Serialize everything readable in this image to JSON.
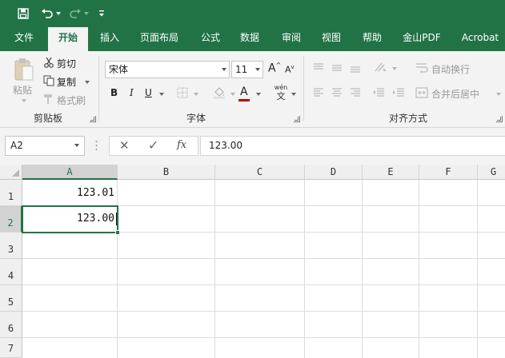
{
  "quick_access": {
    "icons": [
      "save-icon",
      "undo-icon",
      "redo-icon",
      "customize-icon"
    ]
  },
  "tabs": [
    {
      "label": "文件",
      "active": false
    },
    {
      "label": "开始",
      "active": true
    },
    {
      "label": "插入",
      "active": false
    },
    {
      "label": "页面布局",
      "active": false
    },
    {
      "label": "公式",
      "active": false
    },
    {
      "label": "数据",
      "active": false
    },
    {
      "label": "审阅",
      "active": false
    },
    {
      "label": "视图",
      "active": false
    },
    {
      "label": "帮助",
      "active": false
    },
    {
      "label": "金山PDF",
      "active": false
    },
    {
      "label": "Acrobat",
      "active": false
    }
  ],
  "clipboard": {
    "group_label": "剪贴板",
    "paste_label": "粘贴",
    "cut_label": "剪切",
    "copy_label": "复制",
    "format_painter_label": "格式刷"
  },
  "font": {
    "group_label": "字体",
    "font_name": "宋体",
    "font_size": "11",
    "bold_label": "B",
    "italic_label": "I",
    "underline_label": "U",
    "grow_label": "A",
    "shrink_label": "A",
    "font_color_label": "A",
    "phonetic_label": "wén",
    "phonetic_sub": "文"
  },
  "alignment": {
    "group_label": "对齐方式",
    "wrap_text_label": "自动换行",
    "merge_center_label": "合并后居中"
  },
  "formula_bar": {
    "name_box": "A2",
    "cancel_symbol": "✕",
    "enter_symbol": "✓",
    "fx_label": "fx",
    "content": "123.00"
  },
  "sheet": {
    "columns": [
      "A",
      "B",
      "C",
      "D",
      "E",
      "F",
      "G"
    ],
    "rows": [
      "1",
      "2",
      "3",
      "4",
      "5",
      "6",
      "7"
    ],
    "cells": {
      "A1": "123.01",
      "A2": "123.00"
    },
    "active_cell": "A2"
  },
  "colors": {
    "brand": "#217346",
    "font_color_swatch": "#c00000"
  }
}
